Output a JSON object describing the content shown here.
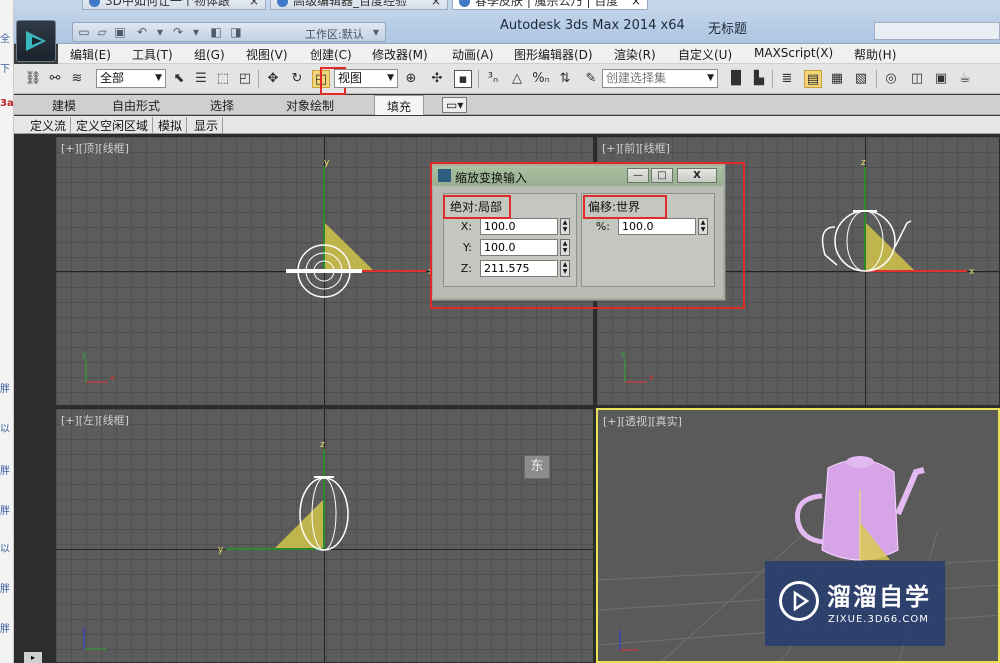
{
  "browser": {
    "tabs": [
      {
        "label": "3D中如何让一个物体跟",
        "close": "×"
      },
      {
        "label": "高级编辑器_百度经验",
        "close": "×"
      },
      {
        "label": "春季皮肤 | 魔宗公乃 | 百度",
        "close": "×"
      }
    ],
    "left_strip_chars": [
      "全",
      "下",
      "3a",
      "胖",
      "以",
      "胖",
      "胖",
      "以",
      "胖",
      "胖"
    ]
  },
  "app": {
    "name": "Autodesk 3ds Max  2014 x64",
    "document": "无标题",
    "workspace_label": "工作区:默认"
  },
  "menu": [
    "编辑(E)",
    "工具(T)",
    "组(G)",
    "视图(V)",
    "创建(C)",
    "修改器(M)",
    "动画(A)",
    "图形编辑器(D)",
    "渲染(R)",
    "自定义(U)",
    "MAXScript(X)",
    "帮助(H)"
  ],
  "toolbar": {
    "selection_filter": "全部",
    "reference_coord": "视图",
    "named_selection_placeholder": "创建选择集"
  },
  "ribbon": {
    "tabs": [
      "建模",
      "自由形式",
      "选择",
      "对象绘制",
      "填充"
    ],
    "active_tab": "填充",
    "subtabs": [
      "定义流",
      "定义空闲区域",
      "模拟",
      "显示"
    ]
  },
  "viewports": {
    "top": "[+][顶][线框]",
    "front": "[+][前][线框]",
    "left": "[+][左][线框]",
    "perspective": "[+][透视][真实]",
    "viewcube_left": "东"
  },
  "dialog": {
    "title": "缩放变换输入",
    "btn_minimize": "—",
    "btn_restore": "□",
    "btn_close": "X",
    "absolute_group": "绝对:局部",
    "offset_group": "偏移:世界",
    "x_label": "X:",
    "x_value": "100.0",
    "y_label": "Y:",
    "y_value": "100.0",
    "z_label": "Z:",
    "z_value": "211.575",
    "pct_label": "%:",
    "pct_value": "100.0"
  },
  "watermark": {
    "name": "溜溜自学",
    "url": "ZIXUE.3D66.COM"
  },
  "colors": {
    "accent_red": "#e02a2a",
    "active_viewport": "#e9e15a",
    "teapot_pink": "#d7a4e8"
  }
}
